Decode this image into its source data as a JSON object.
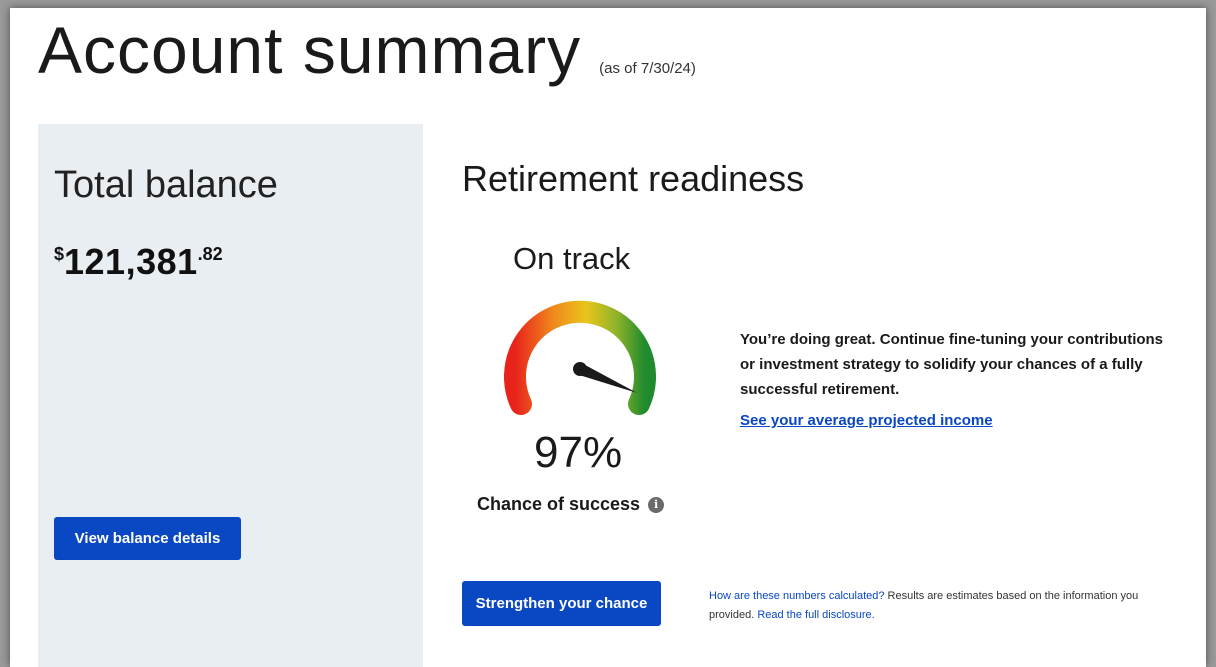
{
  "header": {
    "title": "Account summary",
    "as_of": "(as of 7/30/24)"
  },
  "balance": {
    "label": "Total balance",
    "currency": "$",
    "whole": "121,381",
    "cents": ".82",
    "button_label": "View balance details"
  },
  "readiness": {
    "title": "Retirement readiness",
    "status": "On track",
    "percent_label": "97%",
    "percent_value": 97,
    "chance_label": "Chance of success",
    "info_icon": "i",
    "message": "You’re doing great. Continue fine-tuning your contributions or investment strategy to solidify your chances of a fully successful retirement.",
    "projected_link": "See your average projected income",
    "button_label": "Strengthen your chance",
    "disclosure_link1": "How are these numbers calculated?",
    "disclosure_text": " Results are estimates based on the information you provided. ",
    "disclosure_link2": "Read the full disclosure."
  },
  "colors": {
    "primary": "#0a47c2",
    "panel_bg": "#e9eef2",
    "gauge_red": "#e8231c",
    "gauge_orange": "#f08a1c",
    "gauge_yellow": "#e9c51a",
    "gauge_green": "#1f8a2e"
  }
}
